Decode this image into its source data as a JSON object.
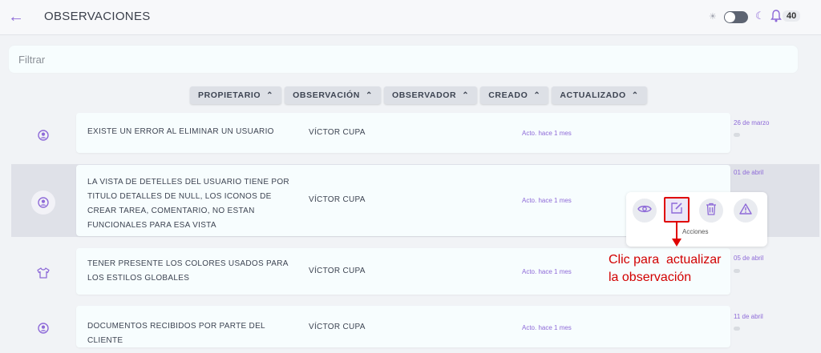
{
  "header": {
    "title": "OBSERVACIONES",
    "notification_count": "40"
  },
  "filter": {
    "placeholder": "Filtrar",
    "value": ""
  },
  "columns": [
    "PROPIETARIO",
    "OBSERVACIÓN",
    "OBSERVADOR",
    "CREADO",
    "ACTUALIZADO"
  ],
  "rows": [
    {
      "owner_icon": "user-circle-icon",
      "observation": "EXISTE UN ERROR AL ELIMINAR UN USUARIO",
      "observer": "VÍCTOR CUPA",
      "created": "Acto. hace 1 mes",
      "updated": "26 de marzo"
    },
    {
      "owner_icon": "user-circle-icon",
      "observation": "LA VISTA DE DETELLES DEL USUARIO TIENE POR TITULO DETALLES DE NULL, LOS ICONOS DE CREAR TAREA, COMENTARIO, NO ESTAN FUNCIONALES PARA ESA VISTA",
      "observer": "VÍCTOR CUPA",
      "created": "Acto. hace 1 mes",
      "updated": "01 de abril"
    },
    {
      "owner_icon": "shirt-icon",
      "observation": "TENER PRESENTE LOS COLORES USADOS PARA LOS ESTILOS GLOBALES",
      "observer": "VÍCTOR CUPA",
      "created": "Acto. hace 1 mes",
      "updated": "05 de abril"
    },
    {
      "owner_icon": "user-circle-icon",
      "observation": "DOCUMENTOS RECIBIDOS POR PARTE DEL CLIENTE",
      "observer": "VÍCTOR CUPA",
      "created": "Acto. hace 1 mes",
      "updated": "11 de abril"
    }
  ],
  "actions": {
    "label": "Acciones",
    "buttons": [
      "eye-icon",
      "edit-icon",
      "trash-icon",
      "warning-icon"
    ]
  },
  "annotation": {
    "line1": "Clic para  actualizar",
    "line2": "la observación"
  },
  "colors": {
    "accent": "#8e6ad8",
    "callout": "#e00000"
  }
}
